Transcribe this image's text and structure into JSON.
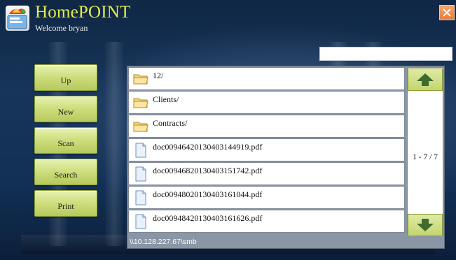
{
  "app": {
    "title": "HomePOINT",
    "welcome": "Welcome bryan"
  },
  "search": {
    "value": ""
  },
  "sidebar": {
    "buttons": [
      {
        "label": "Up"
      },
      {
        "label": "New"
      },
      {
        "label": "Scan"
      },
      {
        "label": "Search"
      },
      {
        "label": "Print"
      }
    ]
  },
  "files": {
    "items": [
      {
        "name": "12/",
        "icon": "folder-icon"
      },
      {
        "name": "Clients/",
        "icon": "folder-icon"
      },
      {
        "name": "Contracts/",
        "icon": "folder-icon"
      },
      {
        "name": "doc00946420130403144919.pdf",
        "icon": "document-icon"
      },
      {
        "name": "doc00946820130403151742.pdf",
        "icon": "document-icon"
      },
      {
        "name": "doc00948020130403161044.pdf",
        "icon": "document-icon"
      },
      {
        "name": "doc00948420130403161626.pdf",
        "icon": "document-icon"
      }
    ],
    "page_info": "1 - 7 / 7",
    "path": "\\\\10.128.227.67\\smb"
  },
  "colors": {
    "title": "#e2ea4e",
    "button_green": "#cfdf7f",
    "arrow_green": "#3f6b2f",
    "close_orange": "#e97a3a"
  }
}
